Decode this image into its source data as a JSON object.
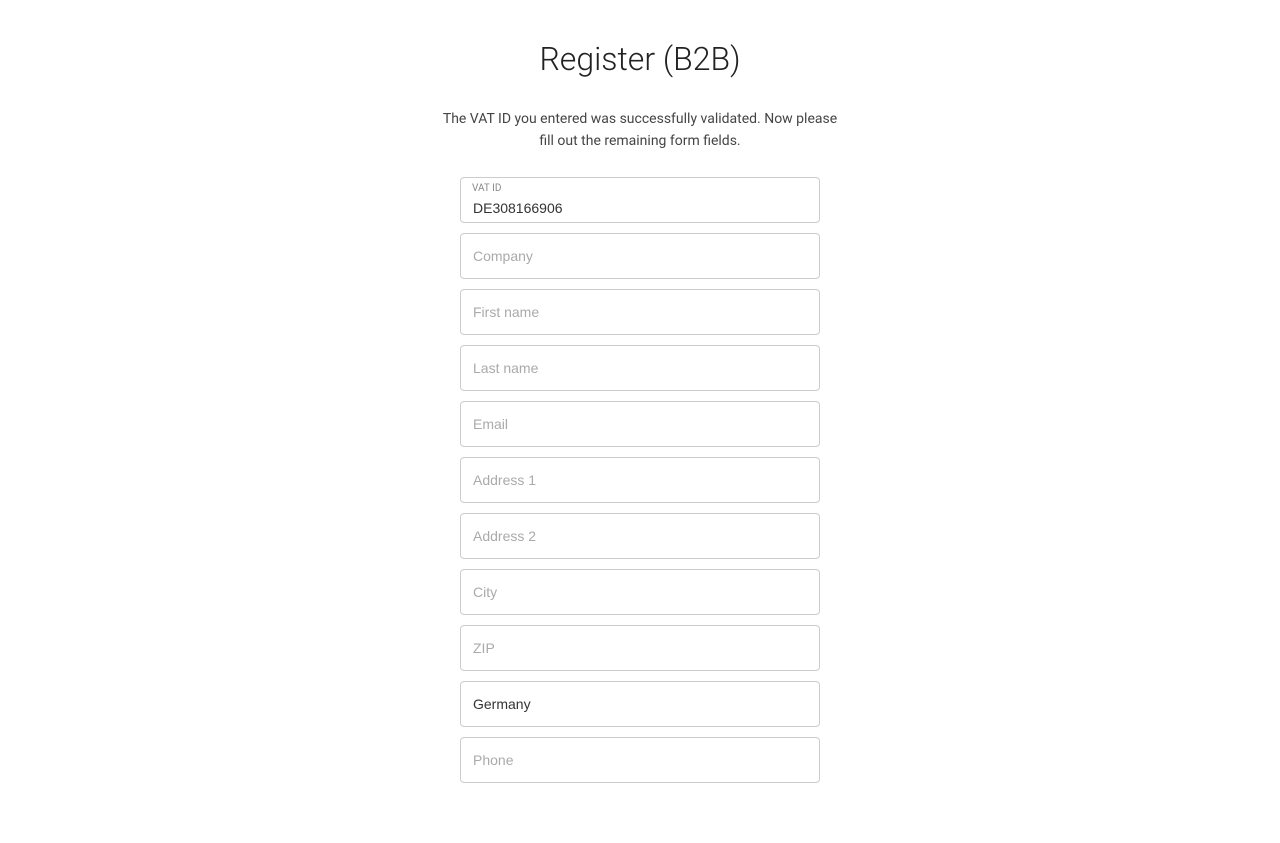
{
  "page": {
    "title": "Register (B2B)",
    "info_line1": "The VAT ID you entered was successfully validated. Now please",
    "info_line2": "fill out the remaining form fields."
  },
  "form": {
    "vat_id": {
      "label": "VAT ID",
      "value": "DE308166906",
      "placeholder": ""
    },
    "company": {
      "placeholder": "Company"
    },
    "first_name": {
      "placeholder": "First name"
    },
    "last_name": {
      "placeholder": "Last name"
    },
    "email": {
      "placeholder": "Email"
    },
    "address1": {
      "placeholder": "Address 1"
    },
    "address2": {
      "placeholder": "Address 2"
    },
    "city": {
      "placeholder": "City"
    },
    "zip": {
      "placeholder": "ZIP"
    },
    "country": {
      "value": "Germany"
    },
    "phone": {
      "placeholder": "Phone"
    }
  }
}
